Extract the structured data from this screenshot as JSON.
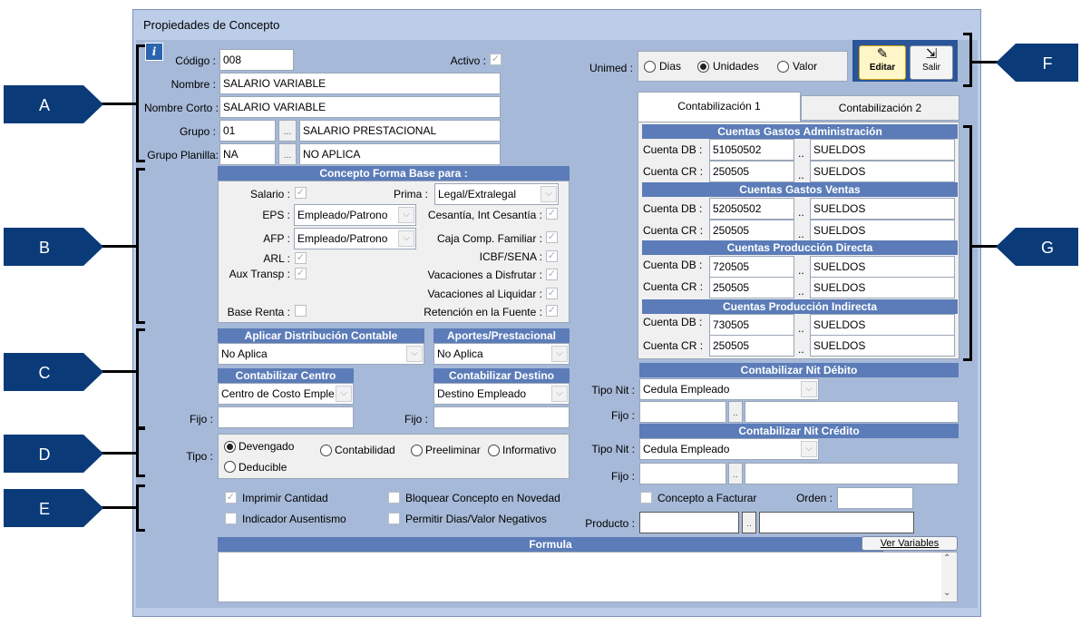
{
  "window": {
    "title": "Propiedades de Concepto"
  },
  "callouts": [
    "A",
    "B",
    "C",
    "D",
    "E",
    "F",
    "G"
  ],
  "header_fields": {
    "codigo_label": "Código :",
    "codigo_value": "008",
    "activo_label": "Activo :",
    "nombre_label": "Nombre :",
    "nombre_value": "SALARIO VARIABLE",
    "nombre_corto_label": "Nombre Corto :",
    "nombre_corto_value": "SALARIO VARIABLE",
    "grupo_label": "Grupo :",
    "grupo_code": "01",
    "grupo_name": "SALARIO PRESTACIONAL",
    "grupo_planilla_label": "Grupo Planilla:",
    "grupo_planilla_code": "NA",
    "grupo_planilla_name": "NO APLICA",
    "dots": "..."
  },
  "base_section": {
    "header": "Concepto Forma Base para :",
    "salario_label": "Salario :",
    "prima_label": "Prima :",
    "prima_value": "Legal/Extralegal",
    "eps_label": "EPS :",
    "eps_value": "Empleado/Patrono",
    "cesantia_label": "Cesantía, Int Cesantía :",
    "afp_label": "AFP :",
    "afp_value": "Empleado/Patrono",
    "caja_label": "Caja Comp. Familiar :",
    "arl_label": "ARL :",
    "icbf_label": "ICBF/SENA :",
    "aux_label": "Aux Transp :",
    "vac_disfrutar_label": "Vacaciones a Disfrutar :",
    "vac_liquidar_label": "Vacaciones al Liquidar :",
    "base_renta_label": "Base Renta :",
    "retencion_label": "Retención en la Fuente :"
  },
  "distribution": {
    "aplicar_header": "Aplicar Distribución Contable",
    "aplicar_value": "No Aplica",
    "aportes_header": "Aportes/Prestacional",
    "aportes_value": "No Aplica",
    "centro_header": "Contabilizar Centro",
    "centro_value": "Centro de Costo Emple",
    "destino_header": "Contabilizar Destino",
    "destino_value": "Destino Empleado",
    "fijo_label": "Fijo :"
  },
  "tipo": {
    "label": "Tipo :",
    "options": [
      "Devengado",
      "Contabilidad",
      "Preeliminar",
      "Informativo",
      "Deducible"
    ],
    "selected": "Devengado"
  },
  "flags": {
    "imprimir": "Imprimir Cantidad",
    "bloquear": "Bloquear Concepto en Novedad",
    "ausentismo": "Indicador Ausentismo",
    "permitir": "Permitir Dias/Valor Negativos",
    "facturar": "Concepto a Facturar",
    "orden_label": "Orden :",
    "producto_label": "Producto :"
  },
  "formula": {
    "header": "Formula",
    "ver_variables": "Ver Variables"
  },
  "unimed": {
    "label": "Unimed :",
    "options": [
      "Dias",
      "Unidades",
      "Valor"
    ],
    "selected": "Unidades"
  },
  "toolbar": {
    "editar": "Editar",
    "salir": "Salir"
  },
  "tabs": [
    "Contabilización 1",
    "Contabilización 2"
  ],
  "accounts": [
    {
      "header": "Cuentas Gastos Administración",
      "db": "51050502",
      "db_name": "SUELDOS",
      "cr": "250505",
      "cr_name": "SUELDOS"
    },
    {
      "header": "Cuentas Gastos Ventas",
      "db": "52050502",
      "db_name": "SUELDOS",
      "cr": "250505",
      "cr_name": "SUELDOS"
    },
    {
      "header": "Cuentas Producción Directa",
      "db": "720505",
      "db_name": "SUELDOS",
      "cr": "250505",
      "cr_name": "SUELDOS"
    },
    {
      "header": "Cuentas Producción Indirecta",
      "db": "730505",
      "db_name": "SUELDOS",
      "cr": "250505",
      "cr_name": "SUELDOS"
    }
  ],
  "account_labels": {
    "db": "Cuenta DB :",
    "cr": "Cuenta CR :",
    "dots": ".."
  },
  "nit": {
    "debito_header": "Contabilizar Nit Débito",
    "credito_header": "Contabilizar Nit Crédito",
    "tipo_label": "Tipo Nit :",
    "tipo_value": "Cedula Empleado",
    "fijo_label": "Fijo :"
  }
}
